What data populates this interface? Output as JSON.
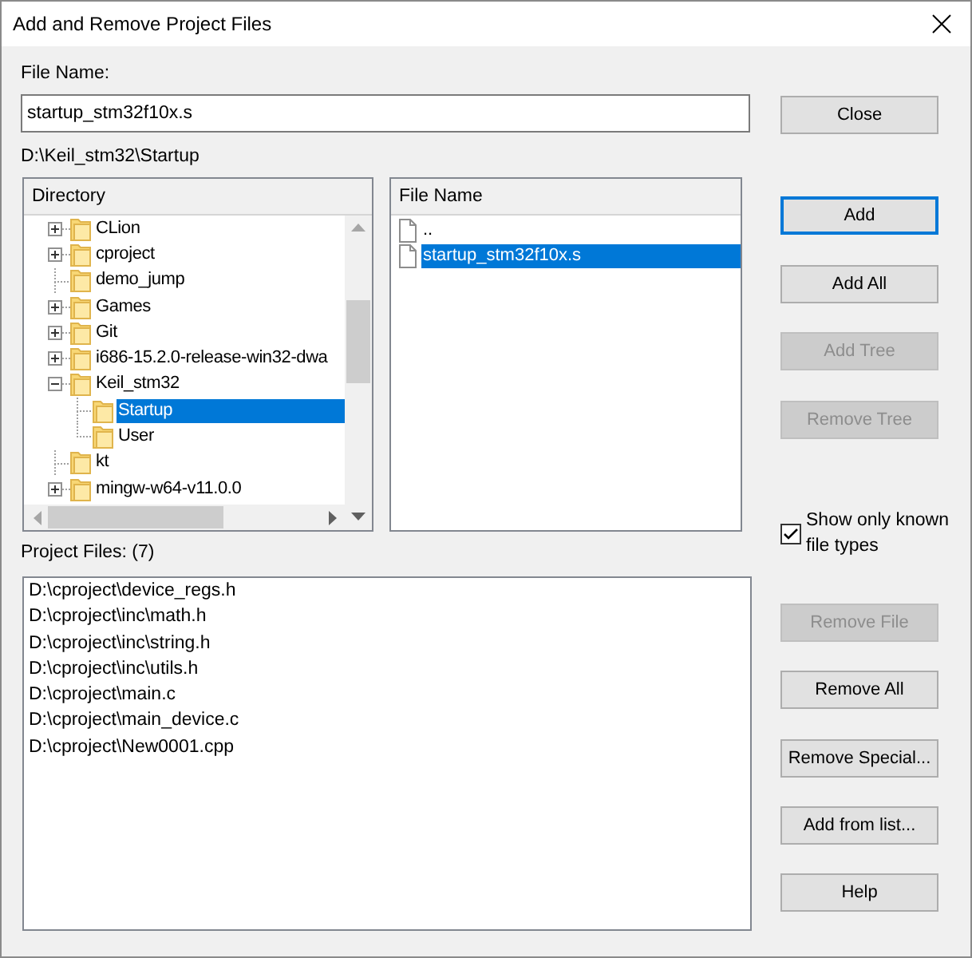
{
  "window": {
    "title": "Add and Remove Project Files"
  },
  "file_name": {
    "label": "File Name:",
    "value": "startup_stm32f10x.s"
  },
  "current_path": "D:\\Keil_stm32\\Startup",
  "directory": {
    "header": "Directory",
    "items": [
      {
        "label": "CLion",
        "expanded": false,
        "selected": false
      },
      {
        "label": "cproject",
        "expanded": false,
        "selected": false
      },
      {
        "label": "demo_jump",
        "selected": false
      },
      {
        "label": "Games",
        "expanded": false,
        "selected": false
      },
      {
        "label": "Git",
        "expanded": false,
        "selected": false
      },
      {
        "label": "i686-15.2.0-release-win32-dwa",
        "expanded": false,
        "selected": false
      },
      {
        "label": "Keil_stm32",
        "expanded": true,
        "selected": false,
        "children": [
          {
            "label": "Startup",
            "selected": true
          },
          {
            "label": "User",
            "selected": false
          }
        ]
      },
      {
        "label": "kt",
        "selected": false
      },
      {
        "label": "mingw-w64-v11.0.0",
        "expanded": false,
        "selected": false
      }
    ]
  },
  "file_list": {
    "header": "File Name",
    "items": [
      {
        "label": "..",
        "selected": false
      },
      {
        "label": "startup_stm32f10x.s",
        "selected": true
      }
    ]
  },
  "close_button": {
    "label": "Close"
  },
  "add_buttons": [
    {
      "label": "Add",
      "disabled": false,
      "focused": true
    },
    {
      "label": "Add All",
      "disabled": false,
      "focused": false
    },
    {
      "label": "Add Tree",
      "disabled": true,
      "focused": false
    },
    {
      "label": "Remove Tree",
      "disabled": true,
      "focused": false
    }
  ],
  "show_only_known": {
    "label": "Show only known file types",
    "checked": true
  },
  "project_files": {
    "label": "Project Files: (7)",
    "items": [
      "D:\\cproject\\device_regs.h",
      "D:\\cproject\\inc\\math.h",
      "D:\\cproject\\inc\\string.h",
      "D:\\cproject\\inc\\utils.h",
      "D:\\cproject\\main.c",
      "D:\\cproject\\main_device.c",
      "D:\\cproject\\New0001.cpp"
    ]
  },
  "project_buttons": [
    {
      "label": "Remove File",
      "disabled": true,
      "focused": false
    },
    {
      "label": "Remove All",
      "disabled": false,
      "focused": false
    },
    {
      "label": "Remove Special...",
      "disabled": false,
      "focused": false
    },
    {
      "label": "Add from list...",
      "disabled": false,
      "focused": false
    },
    {
      "label": "Help",
      "disabled": false,
      "focused": false
    }
  ]
}
